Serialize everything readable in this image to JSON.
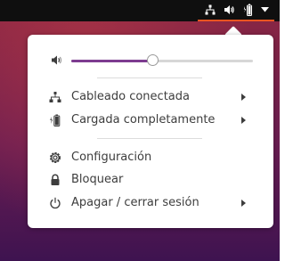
{
  "topbar": {
    "icons": [
      "network-wired-icon",
      "volume-icon",
      "battery-icon",
      "dropdown-arrow-icon"
    ]
  },
  "menu": {
    "volume": {
      "icon": "volume-icon",
      "level": 0.45
    },
    "items": [
      {
        "label": "Cableado conectada",
        "icon": "network-wired-icon",
        "has_submenu": true
      },
      {
        "label": "Cargada completamente",
        "icon": "battery-charging-icon",
        "has_submenu": true
      },
      {
        "label": "Configuración",
        "icon": "settings-gear-icon",
        "has_submenu": false
      },
      {
        "label": "Bloquear",
        "icon": "lock-icon",
        "has_submenu": false
      },
      {
        "label": "Apagar / cerrar sesión",
        "icon": "power-icon",
        "has_submenu": true
      }
    ]
  },
  "colors": {
    "panel": "#0f0f0f",
    "accent": "#e95420",
    "slider_fill": "#7d3c90",
    "menu_bg": "#ffffff",
    "text": "#3d3d3d"
  }
}
